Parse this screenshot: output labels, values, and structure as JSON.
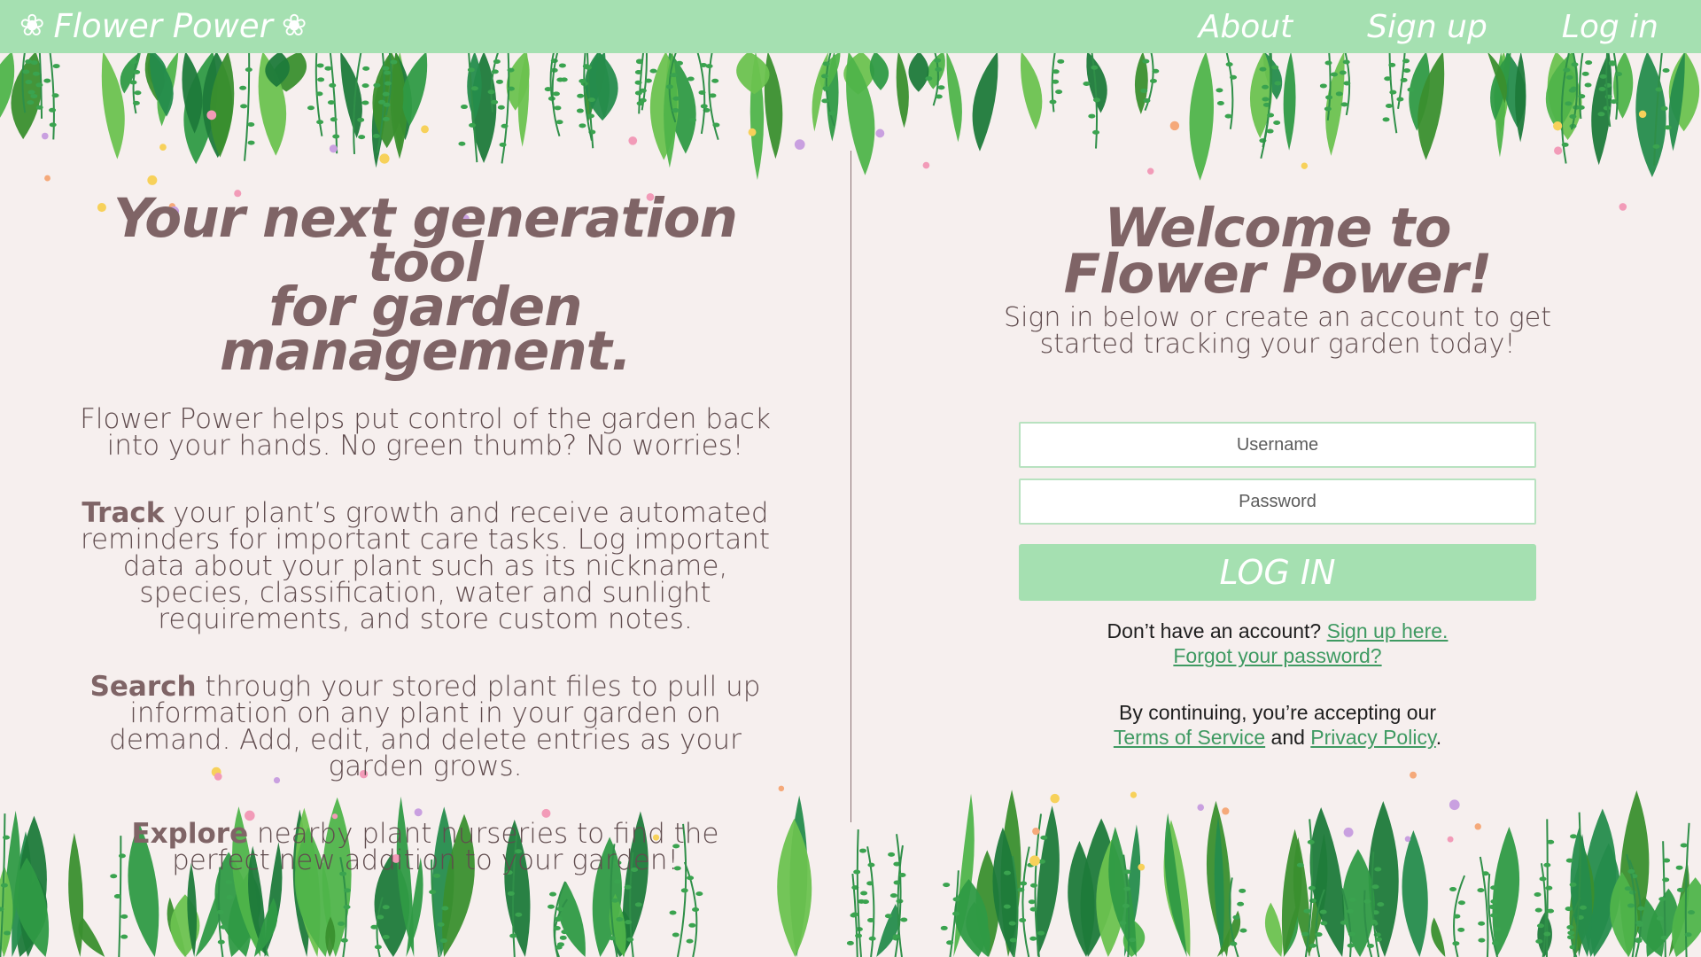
{
  "navbar": {
    "brand_left_icon": "❀",
    "brand_name": "Flower Power",
    "brand_right_icon": "❀",
    "links": {
      "about": "About",
      "signup": "Sign up",
      "login": "Log in"
    }
  },
  "left": {
    "title_line1": "Your next generation tool",
    "title_line2": "for garden management.",
    "subtitle": "Flower Power helps put control of the garden back into your hands. No green thumb? No worries!",
    "features": [
      {
        "keyword": "Track",
        "text": " your plant’s growth and receive automated reminders for important care tasks. Log important data about your plant such as its nickname, species, classification, water and sunlight requirements, and store custom notes."
      },
      {
        "keyword": "Search",
        "text": " through your stored plant files to pull up information on any plant in your garden on demand. Add, edit, and delete entries as your garden grows."
      },
      {
        "keyword": "Explore",
        "text": " nearby plant nurseries to find the perfect new addition to your garden!"
      }
    ]
  },
  "right": {
    "title_line1": "Welcome to",
    "title_line2": "Flower Power!",
    "subtitle": "Sign in below or create an account to get started tracking your garden today!",
    "form": {
      "username_placeholder": "Username",
      "password_placeholder": "Password",
      "login_button": "LOG IN"
    },
    "no_account_text": "Don’t have an account? ",
    "signup_link": "Sign up here.",
    "forgot_link": "Forgot your password?",
    "legal_prefix": "By continuing, you’re accepting our",
    "terms_link": "Terms of Service",
    "legal_and": " and ",
    "privacy_link": "Privacy Policy",
    "legal_suffix": "."
  },
  "colors": {
    "navbar": "#a5e0b1",
    "background": "#f6efee",
    "heading": "#7f6466",
    "link": "#3f9a62"
  }
}
